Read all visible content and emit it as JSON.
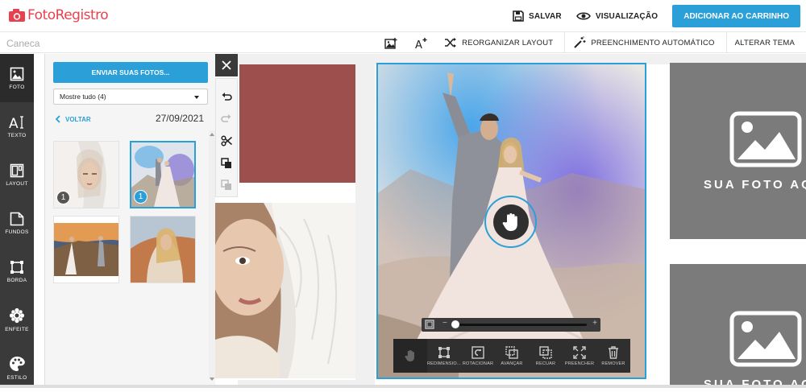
{
  "header": {
    "logo_text": "FotoRegistro",
    "save_label": "SALVAR",
    "preview_label": "VISUALIZAÇÃO",
    "cart_label": "ADICIONAR AO CARRINHO"
  },
  "toolbar": {
    "product_name": "Caneca",
    "rearrange_label": "REORGANIZAR LAYOUT",
    "autofill_label": "PREENCHIMENTO AUTOMÁTICO",
    "theme_label": "ALTERAR TEMA"
  },
  "sidebar": {
    "items": [
      {
        "label": "FOTO",
        "icon": "photo-icon"
      },
      {
        "label": "TEXTO",
        "icon": "text-icon"
      },
      {
        "label": "LAYOUT",
        "icon": "layout-icon"
      },
      {
        "label": "FUNDOS",
        "icon": "background-icon"
      },
      {
        "label": "BORDA",
        "icon": "border-icon"
      },
      {
        "label": "ENFEITE",
        "icon": "decoration-icon"
      },
      {
        "label": "ESTILO",
        "icon": "palette-icon"
      }
    ]
  },
  "panel": {
    "upload_label": "ENVIAR SUAS FOTOS...",
    "filter_value": "Mostre tudo (4)",
    "back_label": "VOLTAR",
    "folder_date": "27/09/2021",
    "thumbs": [
      {
        "badge": "1"
      },
      {
        "badge": "1"
      },
      {
        "badge": ""
      },
      {
        "badge": ""
      }
    ]
  },
  "placeholders": {
    "text": "SUA FOTO AQUI"
  },
  "photo_tools": {
    "resize_label": "REDIMENSIO...",
    "rotate_label": "ROTACIONAR",
    "forward_label": "AVANÇAR",
    "back_label": "RECUAR",
    "fill_label": "PREENCHER",
    "remove_label": "REMOVER"
  },
  "colors": {
    "accent": "#2a9fd8",
    "brand": "#e8414e",
    "nav_bg": "#3a3a3a",
    "placeholder_bg": "#7b7b7b",
    "block_red": "#9c4f4d"
  }
}
